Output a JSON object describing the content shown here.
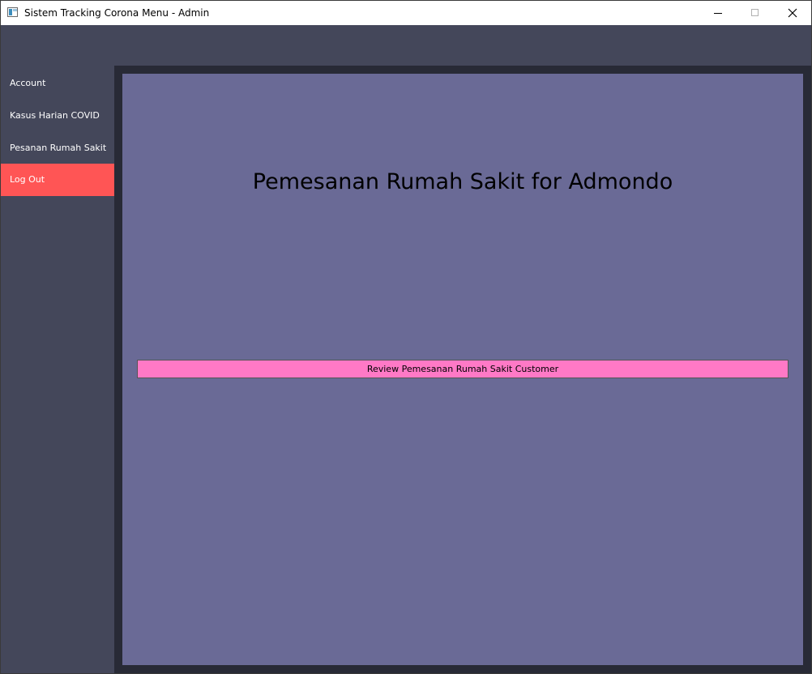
{
  "window": {
    "title": "Sistem Tracking Corona Menu - Admin",
    "controls": {
      "minimize": "minimize-icon",
      "maximize": "maximize-icon",
      "close": "close-icon"
    }
  },
  "sidebar": {
    "items": [
      {
        "label": "Account"
      },
      {
        "label": "Kasus Harian COVID"
      },
      {
        "label": "Pesanan Rumah Sakit"
      },
      {
        "label": "Log Out"
      }
    ]
  },
  "main": {
    "heading": "Pemesanan Rumah Sakit for Admondo",
    "review_button_label": "Review Pemesanan Rumah Sakit Customer"
  },
  "colors": {
    "background": "#44475a",
    "content_frame": "#282a36",
    "content_panel": "#6a6a96",
    "logout_accent": "#ff5555",
    "review_button": "#ff79c6"
  }
}
